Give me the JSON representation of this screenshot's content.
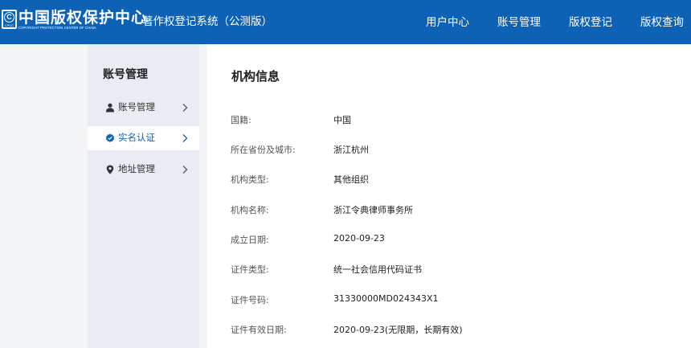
{
  "header": {
    "logo_icon_text": "C",
    "logo_icon_abbr": "CPCC",
    "logo_cn": "中国版权保护中心",
    "logo_en": "COPYRIGHT PROTECTION CENTER OF CHINA",
    "system_name": "著作权登记系统（公测版）",
    "nav": [
      "用户中心",
      "账号管理",
      "版权登记",
      "版权查询"
    ],
    "bg_color": "#0d62b5"
  },
  "sidebar": {
    "title": "账号管理",
    "items": [
      {
        "label": "账号管理",
        "icon": "user-icon",
        "active": false
      },
      {
        "label": "实名认证",
        "icon": "verified-badge-icon",
        "active": true
      },
      {
        "label": "地址管理",
        "icon": "location-pin-icon",
        "active": false
      }
    ]
  },
  "main": {
    "title": "机构信息",
    "fields": [
      {
        "label": "国籍:",
        "value": "中国"
      },
      {
        "label": "所在省份及城市:",
        "value": "浙江杭州"
      },
      {
        "label": "机构类型:",
        "value": "其他组织"
      },
      {
        "label": "机构名称:",
        "value": "浙江令典律师事务所"
      },
      {
        "label": "成立日期:",
        "value": "2020-09-23"
      },
      {
        "label": "证件类型:",
        "value": "统一社会信用代码证书"
      },
      {
        "label": "证件号码:",
        "value": "31330000MD024343X1"
      },
      {
        "label": "证件有效日期:",
        "value": "2020-09-23(无限期，长期有效)"
      }
    ]
  },
  "colors": {
    "accent": "#0d62b5",
    "sidebar_bg": "#e9ecf2",
    "page_bg": "#f4f5f7"
  }
}
